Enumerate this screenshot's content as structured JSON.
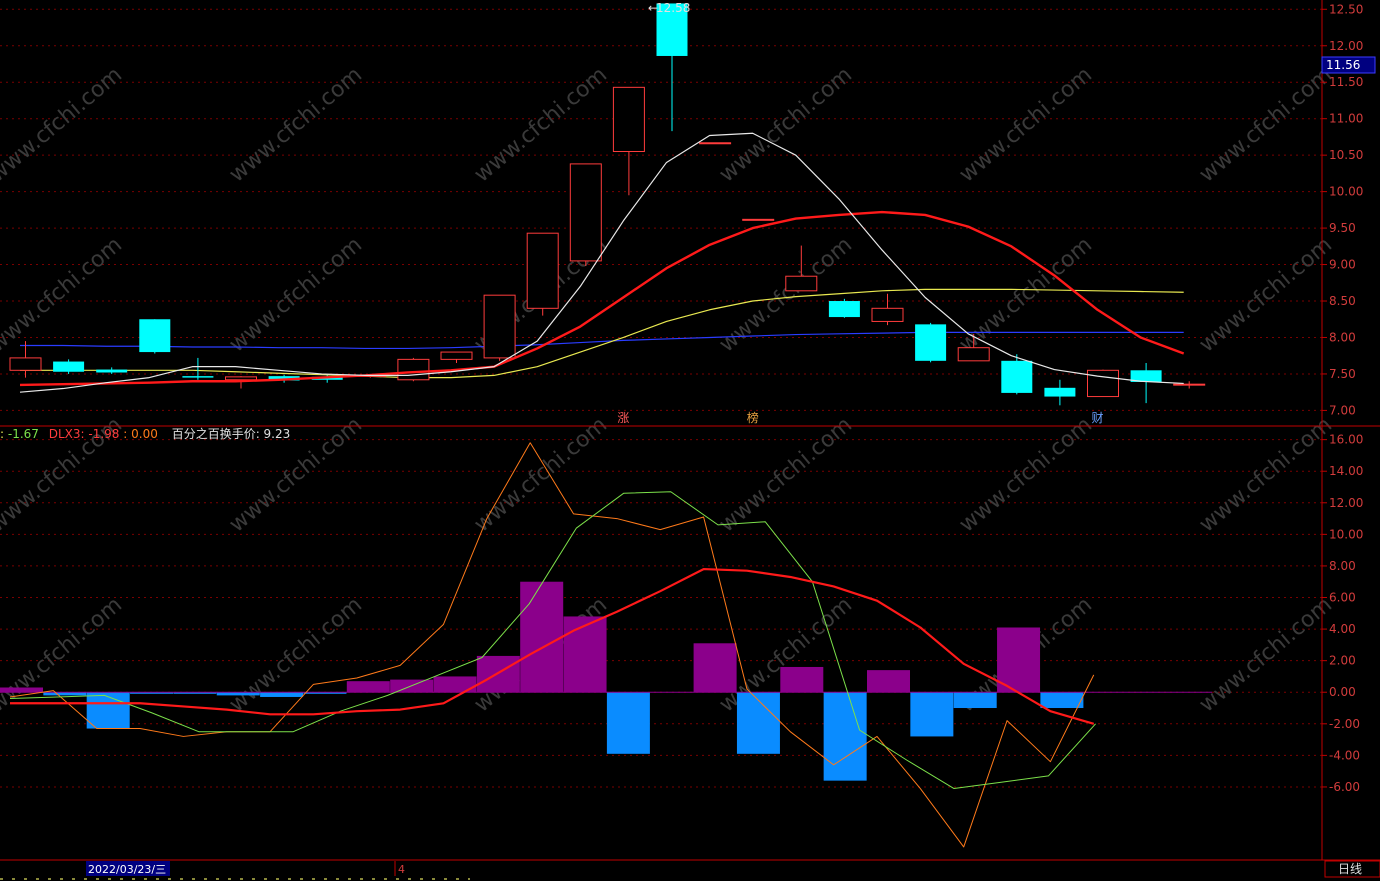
{
  "colors": {
    "background": "#000000",
    "grid": "#7a0000",
    "axis": "#c00000",
    "tick_text": "#d23c3c",
    "candle_up": "#ff3c3c",
    "candle_down": "#00ffff",
    "ma_short": "#e8e8e8",
    "ma_mid": "#ff1a1a",
    "ma_long": "#e8e850",
    "ma_slow": "#2a3cff",
    "hist_positive": "#8b008b",
    "hist_negative": "#0a8cff",
    "line_orange": "#ff7a1a",
    "line_green": "#7ce04a",
    "line_red": "#ff1a1a",
    "price_label_bg": "#000080"
  },
  "chart_data": [
    {
      "type": "candlestick",
      "ylim": [
        6.8,
        12.6
      ],
      "y_ticks": [
        "7.00",
        "7.50",
        "8.00",
        "8.50",
        "9.00",
        "9.50",
        "10.00",
        "10.50",
        "11.00",
        "11.50",
        "12.00",
        "12.50"
      ],
      "current_price_label": "11.56",
      "max_label": "12.58",
      "candles": [
        {
          "o": 7.55,
          "h": 7.95,
          "l": 7.45,
          "c": 7.72
        },
        {
          "o": 7.67,
          "h": 7.7,
          "l": 7.5,
          "c": 7.53
        },
        {
          "o": 7.56,
          "h": 7.59,
          "l": 7.5,
          "c": 7.52
        },
        {
          "o": 8.25,
          "h": 8.25,
          "l": 7.78,
          "c": 7.8
        },
        {
          "o": 7.47,
          "h": 7.72,
          "l": 7.42,
          "c": 7.45
        },
        {
          "o": 7.42,
          "h": 7.47,
          "l": 7.3,
          "c": 7.46
        },
        {
          "o": 7.47,
          "h": 7.49,
          "l": 7.38,
          "c": 7.41
        },
        {
          "o": 7.46,
          "h": 7.48,
          "l": 7.38,
          "c": 7.42
        },
        {
          "o": 7.47,
          "h": 7.5,
          "l": 7.45,
          "c": 7.48
        },
        {
          "o": 7.42,
          "h": 7.72,
          "l": 7.4,
          "c": 7.7
        },
        {
          "o": 7.7,
          "h": 7.8,
          "l": 7.65,
          "c": 7.8
        },
        {
          "o": 7.72,
          "h": 8.58,
          "l": 7.68,
          "c": 8.58
        },
        {
          "o": 8.4,
          "h": 9.43,
          "l": 8.3,
          "c": 9.43
        },
        {
          "o": 9.05,
          "h": 10.38,
          "l": 8.98,
          "c": 10.38
        },
        {
          "o": 10.55,
          "h": 11.43,
          "l": 9.95,
          "c": 11.43
        },
        {
          "o": 12.58,
          "h": 12.58,
          "l": 10.83,
          "c": 11.86
        },
        {
          "o": 10.67,
          "h": 10.67,
          "l": 10.67,
          "c": 10.67
        },
        {
          "o": 9.62,
          "h": 9.62,
          "l": 9.62,
          "c": 9.62
        },
        {
          "o": 8.64,
          "h": 9.26,
          "l": 8.64,
          "c": 8.84
        },
        {
          "o": 8.5,
          "h": 8.53,
          "l": 8.27,
          "c": 8.28
        },
        {
          "o": 8.22,
          "h": 8.6,
          "l": 8.17,
          "c": 8.4
        },
        {
          "o": 8.18,
          "h": 8.2,
          "l": 7.66,
          "c": 7.68
        },
        {
          "o": 7.68,
          "h": 8.05,
          "l": 7.68,
          "c": 7.86
        },
        {
          "o": 7.68,
          "h": 7.77,
          "l": 7.22,
          "c": 7.24
        },
        {
          "o": 7.31,
          "h": 7.42,
          "l": 7.07,
          "c": 7.19
        },
        {
          "o": 7.19,
          "h": 7.56,
          "l": 7.19,
          "c": 7.55
        },
        {
          "o": 7.55,
          "h": 7.65,
          "l": 7.1,
          "c": 7.39
        },
        {
          "o": 7.36,
          "h": 7.4,
          "l": 7.3,
          "c": 7.36
        }
      ],
      "ma_short": [
        7.25,
        7.3,
        7.38,
        7.45,
        7.6,
        7.6,
        7.55,
        7.5,
        7.48,
        7.48,
        7.53,
        7.6,
        7.95,
        8.7,
        9.6,
        10.4,
        10.77,
        10.8,
        10.5,
        9.9,
        9.2,
        8.55,
        8.05,
        7.75,
        7.56,
        7.47,
        7.4,
        7.37
      ],
      "ma_mid": [
        7.35,
        7.36,
        7.37,
        7.38,
        7.4,
        7.4,
        7.42,
        7.45,
        7.48,
        7.52,
        7.55,
        7.6,
        7.85,
        8.15,
        8.55,
        8.95,
        9.27,
        9.5,
        9.63,
        9.68,
        9.72,
        9.68,
        9.52,
        9.25,
        8.85,
        8.38,
        8.0,
        7.78
      ],
      "ma_long": [
        7.55,
        7.55,
        7.55,
        7.55,
        7.55,
        7.53,
        7.51,
        7.49,
        7.47,
        7.45,
        7.45,
        7.48,
        7.6,
        7.8,
        8.0,
        8.22,
        8.38,
        8.5,
        8.56,
        8.6,
        8.64,
        8.66,
        8.66,
        8.66,
        8.65,
        8.64,
        8.63,
        8.62
      ],
      "ma_slow": [
        7.89,
        7.89,
        7.88,
        7.88,
        7.87,
        7.87,
        7.86,
        7.86,
        7.85,
        7.85,
        7.86,
        7.88,
        7.9,
        7.93,
        7.96,
        7.98,
        8.0,
        8.02,
        8.04,
        8.05,
        8.06,
        8.07,
        8.07,
        8.07,
        8.07,
        8.07,
        8.07,
        8.07
      ],
      "markers": [
        {
          "index": 14,
          "label": "涨"
        },
        {
          "index": 17,
          "label": "榜"
        },
        {
          "index": 25,
          "label": "财"
        }
      ]
    },
    {
      "type": "histogram-with-lines",
      "ylim": [
        -10.5,
        16.8
      ],
      "y_ticks": [
        "-6.00",
        "-4.00",
        "-2.00",
        "0.00",
        "2.00",
        "4.00",
        "6.00",
        "8.00",
        "10.00",
        "12.00",
        "14.00",
        "16.00"
      ],
      "histogram": [
        0.3,
        -0.2,
        -2.3,
        -0.1,
        -0.1,
        -0.2,
        -0.3,
        -0.1,
        0.7,
        0.8,
        1.0,
        2.3,
        7.0,
        4.8,
        -3.9,
        0.0,
        3.1,
        -3.9,
        1.6,
        -5.6,
        1.4,
        -2.8,
        -1.0,
        4.1,
        -1.0,
        0.0
      ],
      "line_orange": [
        -0.3,
        0.1,
        -2.3,
        -2.3,
        -2.8,
        -2.5,
        -2.5,
        0.5,
        0.9,
        1.7,
        4.3,
        11.0,
        15.8,
        11.3,
        11.0,
        10.3,
        11.1,
        0.2,
        -2.5,
        -4.6,
        -2.8,
        -6.1,
        -9.8,
        -1.8,
        -4.4,
        1.1
      ],
      "line_green": [
        -0.4,
        -0.3,
        -0.2,
        -1.3,
        -2.5,
        -2.5,
        -2.5,
        -1.2,
        -0.2,
        1.0,
        2.2,
        5.6,
        10.4,
        12.6,
        12.7,
        10.6,
        10.8,
        7.0,
        -2.4,
        -4.3,
        -6.1,
        -5.7,
        -5.3,
        -2.0
      ],
      "line_red": [
        -0.7,
        -0.7,
        -0.7,
        -0.7,
        -0.9,
        -1.1,
        -1.4,
        -1.4,
        -1.2,
        -1.1,
        -0.7,
        0.8,
        2.4,
        3.9,
        5.1,
        6.4,
        7.8,
        7.7,
        7.3,
        6.7,
        5.8,
        4.1,
        1.8,
        0.4,
        -1.2,
        -2.0
      ],
      "legend": {
        "prefix": ": ",
        "first_value": "-1.67",
        "dlx3_label": "DLX3: ",
        "dlx3_value": "-1.98",
        "sep": " : ",
        "zero_value": "0.00",
        "turnover_label": "百分之百换手价: ",
        "turnover_value": "9.23"
      }
    }
  ],
  "bottom_bar": {
    "date_label": "2022/03/23/三",
    "month_marker": "4",
    "period_button": "日线"
  },
  "watermark": "www.cfchi.com"
}
